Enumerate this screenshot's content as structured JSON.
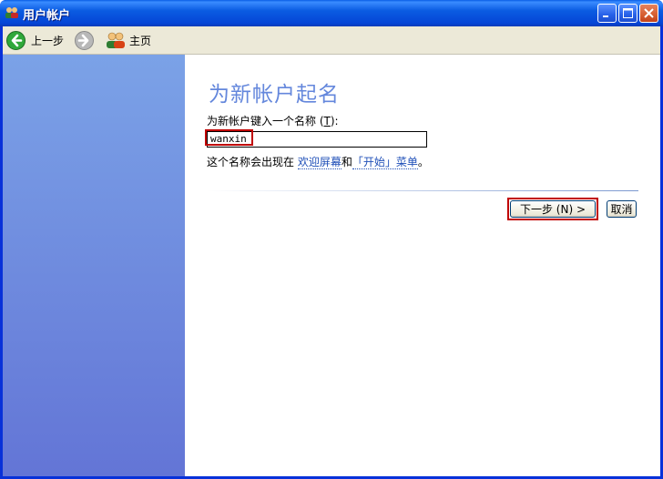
{
  "window": {
    "title": "用户帐户",
    "controls": [
      "minimize",
      "maximize",
      "close"
    ]
  },
  "toolbar": {
    "back_label": "上一步",
    "home_label": "主页"
  },
  "main": {
    "heading": "为新帐户起名",
    "prompt_text": "为新帐户键入一个名称 (",
    "prompt_accel": "T",
    "prompt_suffix": "):",
    "name_value": "wanxin",
    "info_prefix": "这个名称会出现在",
    "info_link1": "欢迎屏幕",
    "info_mid": "和",
    "info_link2": "「开始」菜单",
    "info_suffix": "。",
    "next_label": "下一步 (N) >",
    "cancel_label": "取消"
  },
  "colors": {
    "titlebar": "#0b5ce2",
    "heading": "#6487dc",
    "link": "#2050b8",
    "highlight": "#c00000",
    "left_pane_top": "#7ba2e7",
    "left_pane_bottom": "#6375d6"
  }
}
